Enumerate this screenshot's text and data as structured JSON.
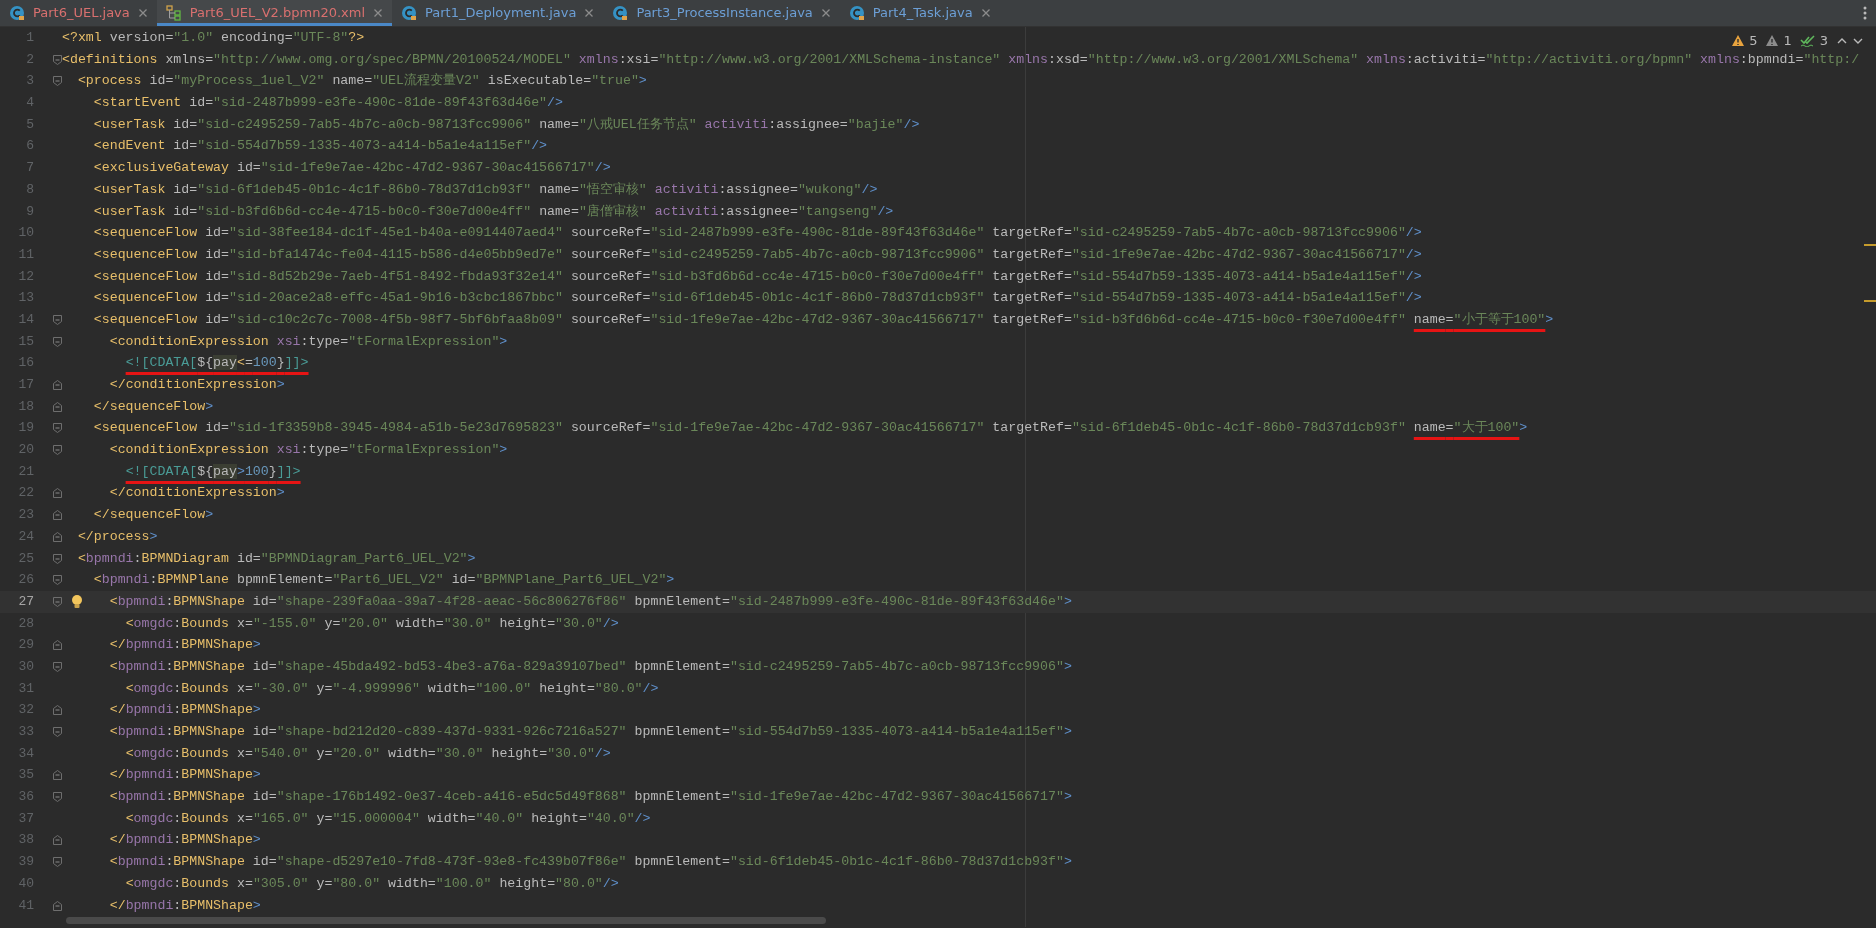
{
  "tabs": [
    {
      "label": "Part6_UEL.java",
      "kind": "java",
      "color": "#d9706f",
      "selected": false
    },
    {
      "label": "Part6_UEL_V2.bpmn20.xml",
      "kind": "xml",
      "color": "#d9706f",
      "selected": true
    },
    {
      "label": "Part1_Deployment.java",
      "kind": "java",
      "color": "#6c9fd6",
      "selected": false
    },
    {
      "label": "Part3_ProcessInstance.java",
      "kind": "java",
      "color": "#6c9fd6",
      "selected": false
    },
    {
      "label": "Part4_Task.java",
      "kind": "java",
      "color": "#6c9fd6",
      "selected": false
    }
  ],
  "inspections": {
    "warnings": "5",
    "weak_warnings": "1",
    "typos": "3"
  },
  "lines": [
    {
      "n": "1",
      "text": "<?xml version=\"1.0\" encoding=\"UTF-8\"?>",
      "kind": "plain",
      "current": false
    },
    {
      "n": "2",
      "text": "<definitions xmlns=\"http://www.omg.org/spec/BPMN/20100524/MODEL\" xmlns:xsi=\"http://www.w3.org/2001/XMLSchema-instance\" xmlns:xsd=\"http://www.w3.org/2001/XMLSchema\" xmlns:activiti=\"http://activiti.org/bpmn\" xmlns:bpmndi=\"http:/",
      "kind": "open",
      "current": false
    },
    {
      "n": "3",
      "text": "  <process id=\"myProcess_1uel_V2\" name=\"UEL流程变量V2\" isExecutable=\"true\">",
      "kind": "open",
      "current": false
    },
    {
      "n": "4",
      "text": "    <startEvent id=\"sid-2487b999-e3fe-490c-81de-89f43f63d46e\"/>",
      "kind": "plain",
      "current": false
    },
    {
      "n": "5",
      "text": "    <userTask id=\"sid-c2495259-7ab5-4b7c-a0cb-98713fcc9906\" name=\"八戒UEL任务节点\" activiti:assignee=\"bajie\"/>",
      "kind": "plain",
      "current": false
    },
    {
      "n": "6",
      "text": "    <endEvent id=\"sid-554d7b59-1335-4073-a414-b5a1e4a115ef\"/>",
      "kind": "plain",
      "current": false
    },
    {
      "n": "7",
      "text": "    <exclusiveGateway id=\"sid-1fe9e7ae-42bc-47d2-9367-30ac41566717\"/>",
      "kind": "plain",
      "current": false
    },
    {
      "n": "8",
      "text": "    <userTask id=\"sid-6f1deb45-0b1c-4c1f-86b0-78d37d1cb93f\" name=\"悟空审核\" activiti:assignee=\"wukong\"/>",
      "kind": "plain",
      "current": false
    },
    {
      "n": "9",
      "text": "    <userTask id=\"sid-b3fd6b6d-cc4e-4715-b0c0-f30e7d00e4ff\" name=\"唐僧审核\" activiti:assignee=\"tangseng\"/>",
      "kind": "plain",
      "current": false
    },
    {
      "n": "10",
      "text": "    <sequenceFlow id=\"sid-38fee184-dc1f-45e1-b40a-e0914407aed4\" sourceRef=\"sid-2487b999-e3fe-490c-81de-89f43f63d46e\" targetRef=\"sid-c2495259-7ab5-4b7c-a0cb-98713fcc9906\"/>",
      "kind": "plain",
      "current": false
    },
    {
      "n": "11",
      "text": "    <sequenceFlow id=\"sid-bfa1474c-fe04-4115-b586-d4e05bb9ed7e\" sourceRef=\"sid-c2495259-7ab5-4b7c-a0cb-98713fcc9906\" targetRef=\"sid-1fe9e7ae-42bc-47d2-9367-30ac41566717\"/>",
      "kind": "plain",
      "current": false
    },
    {
      "n": "12",
      "text": "    <sequenceFlow id=\"sid-8d52b29e-7aeb-4f51-8492-fbda93f32e14\" sourceRef=\"sid-b3fd6b6d-cc4e-4715-b0c0-f30e7d00e4ff\" targetRef=\"sid-554d7b59-1335-4073-a414-b5a1e4a115ef\"/>",
      "kind": "plain",
      "current": false
    },
    {
      "n": "13",
      "text": "    <sequenceFlow id=\"sid-20ace2a8-effc-45a1-9b16-b3cbc1867bbc\" sourceRef=\"sid-6f1deb45-0b1c-4c1f-86b0-78d37d1cb93f\" targetRef=\"sid-554d7b59-1335-4073-a414-b5a1e4a115ef\"/>",
      "kind": "plain",
      "current": false
    },
    {
      "n": "14",
      "text": "    <sequenceFlow id=\"sid-c10c2c7c-7008-4f5b-98f7-5bf6bfaa8b09\" sourceRef=\"sid-1fe9e7ae-42bc-47d2-9367-30ac41566717\" targetRef=\"sid-b3fd6b6d-cc4e-4715-b0c0-f30e7d00e4ff\" ",
      "marked": "name=\"小于等于100\"",
      "after": ">",
      "kind": "open",
      "current": false
    },
    {
      "n": "15",
      "text": "      <conditionExpression xsi:type=\"tFormalExpression\">",
      "kind": "open",
      "current": false
    },
    {
      "n": "16",
      "marked": "        <![CDATA[${pay<=100}]]>",
      "kind": "plain",
      "current": false
    },
    {
      "n": "17",
      "text": "      </conditionExpression>",
      "kind": "close",
      "current": false
    },
    {
      "n": "18",
      "text": "    </sequenceFlow>",
      "kind": "close",
      "current": false
    },
    {
      "n": "19",
      "text": "    <sequenceFlow id=\"sid-1f3359b8-3945-4984-a51b-5e23d7695823\" sourceRef=\"sid-1fe9e7ae-42bc-47d2-9367-30ac41566717\" targetRef=\"sid-6f1deb45-0b1c-4c1f-86b0-78d37d1cb93f\" ",
      "marked": "name=\"大于100\"",
      "after": ">",
      "kind": "open",
      "current": false
    },
    {
      "n": "20",
      "text": "      <conditionExpression xsi:type=\"tFormalExpression\">",
      "kind": "open",
      "current": false
    },
    {
      "n": "21",
      "marked": "        <![CDATA[${pay>100}]]>",
      "kind": "plain",
      "current": false
    },
    {
      "n": "22",
      "text": "      </conditionExpression>",
      "kind": "close",
      "current": false
    },
    {
      "n": "23",
      "text": "    </sequenceFlow>",
      "kind": "close",
      "current": false
    },
    {
      "n": "24",
      "text": "  </process>",
      "kind": "close",
      "current": false
    },
    {
      "n": "25",
      "text": "  <bpmndi:BPMNDiagram id=\"BPMNDiagram_Part6_UEL_V2\">",
      "kind": "open",
      "current": false
    },
    {
      "n": "26",
      "text": "    <bpmndi:BPMNPlane bpmnElement=\"Part6_UEL_V2\" id=\"BPMNPlane_Part6_UEL_V2\">",
      "kind": "open",
      "current": false
    },
    {
      "n": "27",
      "text": "      <bpmndi:BPMNShape id=\"shape-239fa0aa-39a7-4f28-aeac-56c806276f86\" bpmnElement=\"sid-2487b999-e3fe-490c-81de-89f43f63d46e\">",
      "kind": "open",
      "current": true
    },
    {
      "n": "28",
      "text": "        <omgdc:Bounds x=\"-155.0\" y=\"20.0\" width=\"30.0\" height=\"30.0\"/>",
      "kind": "plain",
      "current": false
    },
    {
      "n": "29",
      "text": "      </bpmndi:BPMNShape>",
      "kind": "close",
      "current": false
    },
    {
      "n": "30",
      "text": "      <bpmndi:BPMNShape id=\"shape-45bda492-bd53-4be3-a76a-829a39107bed\" bpmnElement=\"sid-c2495259-7ab5-4b7c-a0cb-98713fcc9906\">",
      "kind": "open",
      "current": false
    },
    {
      "n": "31",
      "text": "        <omgdc:Bounds x=\"-30.0\" y=\"-4.999996\" width=\"100.0\" height=\"80.0\"/>",
      "kind": "plain",
      "current": false
    },
    {
      "n": "32",
      "text": "      </bpmndi:BPMNShape>",
      "kind": "close",
      "current": false
    },
    {
      "n": "33",
      "text": "      <bpmndi:BPMNShape id=\"shape-bd212d20-c839-437d-9331-926c7216a527\" bpmnElement=\"sid-554d7b59-1335-4073-a414-b5a1e4a115ef\">",
      "kind": "open",
      "current": false
    },
    {
      "n": "34",
      "text": "        <omgdc:Bounds x=\"540.0\" y=\"20.0\" width=\"30.0\" height=\"30.0\"/>",
      "kind": "plain",
      "current": false
    },
    {
      "n": "35",
      "text": "      </bpmndi:BPMNShape>",
      "kind": "close",
      "current": false
    },
    {
      "n": "36",
      "text": "      <bpmndi:BPMNShape id=\"shape-176b1492-0e37-4ceb-a416-e5dc5d49f868\" bpmnElement=\"sid-1fe9e7ae-42bc-47d2-9367-30ac41566717\">",
      "kind": "open",
      "current": false
    },
    {
      "n": "37",
      "text": "        <omgdc:Bounds x=\"165.0\" y=\"15.000004\" width=\"40.0\" height=\"40.0\"/>",
      "kind": "plain",
      "current": false
    },
    {
      "n": "38",
      "text": "      </bpmndi:BPMNShape>",
      "kind": "close",
      "current": false
    },
    {
      "n": "39",
      "text": "      <bpmndi:BPMNShape id=\"shape-d5297e10-7fd8-473f-93e8-fc439b07f86e\" bpmnElement=\"sid-6f1deb45-0b1c-4c1f-86b0-78d37d1cb93f\">",
      "kind": "open",
      "current": false
    },
    {
      "n": "40",
      "text": "        <omgdc:Bounds x=\"305.0\" y=\"80.0\" width=\"100.0\" height=\"80.0\"/>",
      "kind": "plain",
      "current": false
    },
    {
      "n": "41",
      "text": "      </bpmndi:BPMNShape>",
      "kind": "close",
      "current": false
    }
  ]
}
